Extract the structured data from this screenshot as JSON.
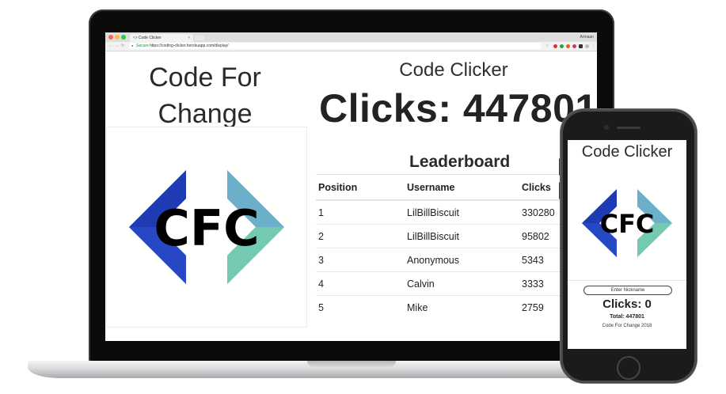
{
  "browser": {
    "tab_title": "Code Clicker",
    "tab_close": "×",
    "profile": "Armaan",
    "secure_label": "Secure",
    "url": "https://coding-clicker.herokuapp.com/display/"
  },
  "page": {
    "org_title_line1": "Code For",
    "org_title_line2": "Change",
    "logo_text": "CFC",
    "app_title": "Code Clicker",
    "clicks_label": "Clicks: 447801"
  },
  "leaderboard": {
    "title": "Leaderboard",
    "headers": [
      "Position",
      "Username",
      "Clicks"
    ],
    "rows": [
      {
        "position": "1",
        "username": "LilBillBiscuit",
        "clicks": "330280"
      },
      {
        "position": "2",
        "username": "LilBillBiscuit",
        "clicks": "95802"
      },
      {
        "position": "3",
        "username": "Anonymous",
        "clicks": "5343"
      },
      {
        "position": "4",
        "username": "Calvin",
        "clicks": "3333"
      },
      {
        "position": "5",
        "username": "Mike",
        "clicks": "2759"
      }
    ]
  },
  "mobile": {
    "title": "Code Clicker",
    "logo_text": "CFC",
    "nickname_placeholder": "Enter Nickname",
    "clicks_label": "Clicks: 0",
    "total_label": "Total: 447801",
    "footer": "Code For Change 2018"
  },
  "colors": {
    "logo_dark_blue": "#1f3bb3",
    "logo_light_blue": "#6bb0c8",
    "logo_teal": "#74c9b2"
  },
  "icons": [
    "back-icon",
    "forward-icon",
    "reload-icon",
    "lock-icon",
    "star-icon",
    "extension-icon",
    "menu-icon"
  ]
}
